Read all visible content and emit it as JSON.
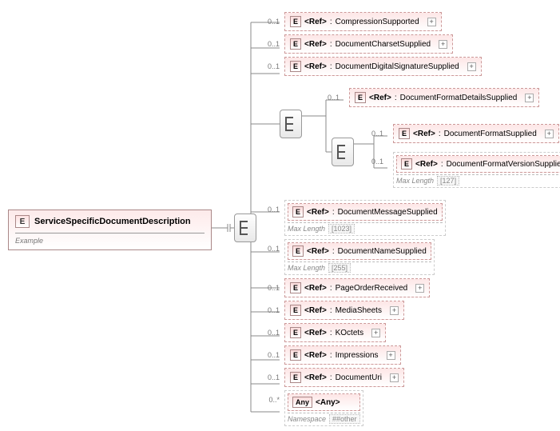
{
  "root": {
    "badge": "E",
    "name": "ServiceSpecificDocumentDescription",
    "annotation": "Example"
  },
  "cardinality": {
    "optional": "0..1",
    "many": "0..*"
  },
  "refLabel": "<Ref>",
  "anyLabel": "<Any>",
  "colon": ":",
  "children": [
    {
      "type": "CompressionSupported"
    },
    {
      "type": "DocumentCharsetSupplied"
    },
    {
      "type": "DocumentDigitalSignatureSupplied"
    }
  ],
  "formatGroup": {
    "details": "DocumentFormatDetailsSupplied",
    "format": "DocumentFormatSupplied",
    "version": {
      "type": "DocumentFormatVersionSupplied",
      "maxLenLabel": "Max Length",
      "maxLen": "[127]"
    }
  },
  "children2": [
    {
      "type": "DocumentMessageSupplied",
      "maxLenLabel": "Max Length",
      "maxLen": "[1023]"
    },
    {
      "type": "DocumentNameSupplied",
      "maxLenLabel": "Max Length",
      "maxLen": "[255]"
    },
    {
      "type": "PageOrderReceived"
    },
    {
      "type": "MediaSheets"
    },
    {
      "type": "KOctets"
    },
    {
      "type": "Impressions"
    },
    {
      "type": "DocumentUri"
    }
  ],
  "anyNode": {
    "nsLabel": "Namespace",
    "ns": "##other"
  }
}
